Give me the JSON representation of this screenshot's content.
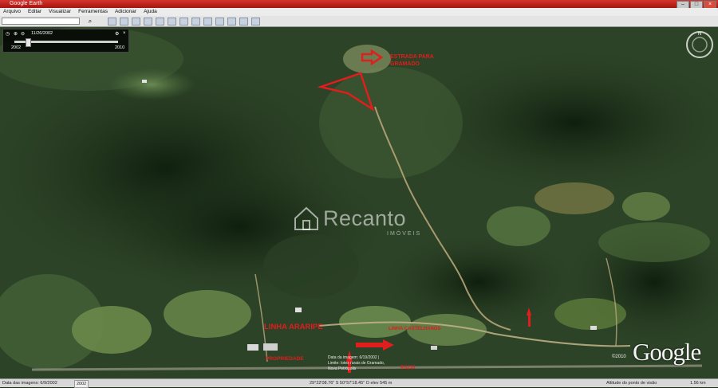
{
  "window": {
    "title": "Google Earth"
  },
  "menu": [
    "Arquivo",
    "Editar",
    "Visualizar",
    "Ferramentas",
    "Adicionar",
    "Ajuda"
  ],
  "time_slider": {
    "date": "11/26/2002",
    "start": "2002",
    "end": "2010"
  },
  "annotations": {
    "estrada_gramado": "ESTRADA PARA GRAMADO",
    "linha_araripe": "LINHA ARARIPE",
    "linha_castelhanos": "LINHA CASTELHANOS",
    "propriedade": "PROPRIEDADE",
    "rs235": "RS235",
    "fineprint": "Data da imagem: 6/19/2002  | Limite: lotes rurais de Gramado, Nova Petrópolis"
  },
  "watermark": {
    "brand": "Recanto",
    "sub": "IMÓVEIS"
  },
  "brand": {
    "google": "Google",
    "copyright": "©2010"
  },
  "status": {
    "left": "Data das imagens: 6/9/2002",
    "year": "2002",
    "coords": "29°22'08.76\" S  50°57'18.45\" O  elev 545 m",
    "eye_label": "Altitude do ponto de visão",
    "eye_value": "1.56 km"
  },
  "colors": {
    "annotation": "#e11d1d",
    "titlebar": "#c4201b"
  }
}
